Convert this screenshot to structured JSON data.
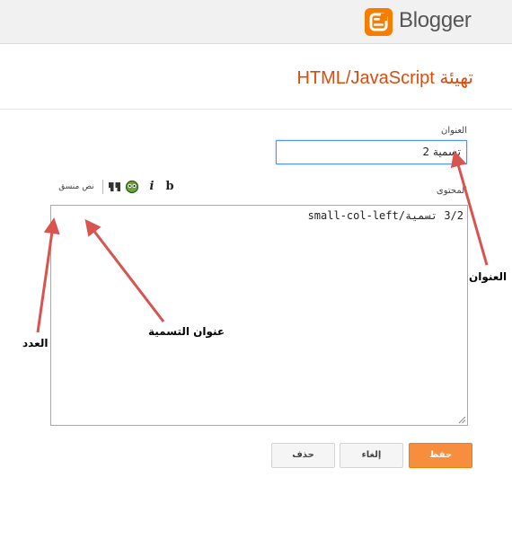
{
  "header": {
    "brand": "Blogger"
  },
  "dialog": {
    "title": "تهيئة HTML/JavaScript",
    "title_label": "العنوان",
    "title_value": "تسمية 2",
    "content_label": "المحتوى",
    "content_value": "3/2 تسمية/small-col-left",
    "toolbar": {
      "bold": "b",
      "italic": "i",
      "rich_text_link": "نص منسق"
    },
    "buttons": {
      "save": "حفظ",
      "cancel": "إلغاء",
      "delete": "حذف"
    }
  },
  "annotations": {
    "title_arrow_label": "العنوان",
    "label_name_arrow_label": "عنوان التسمية",
    "count_arrow_label": "العدد",
    "arrow_color": "#d9534f"
  },
  "colors": {
    "accent": "#f57d00",
    "title": "#dd4b0a",
    "save": "#f68e3d"
  }
}
